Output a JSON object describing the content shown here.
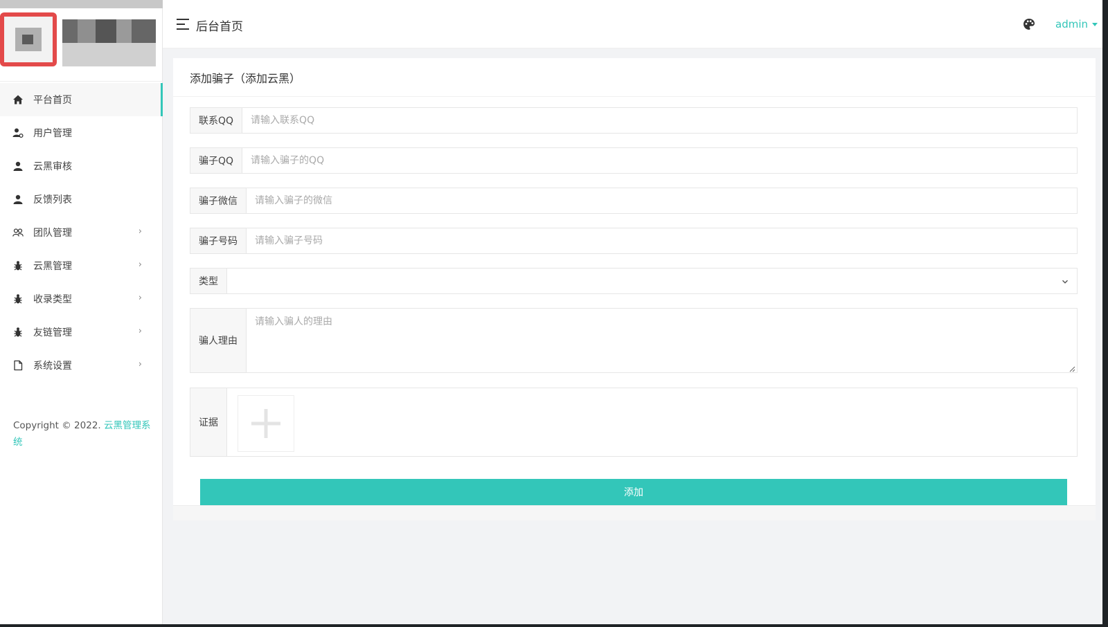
{
  "header": {
    "title": "后台首页",
    "user": "admin"
  },
  "sidebar": {
    "items": [
      {
        "label": "平台首页",
        "icon": "home-icon"
      },
      {
        "label": "用户管理",
        "icon": "user-settings-icon"
      },
      {
        "label": "云黑审核",
        "icon": "user-icon"
      },
      {
        "label": "反馈列表",
        "icon": "user-icon"
      },
      {
        "label": "团队管理",
        "icon": "group-icon",
        "arrow": "›"
      },
      {
        "label": "云黑管理",
        "icon": "bug-icon",
        "arrow": "›"
      },
      {
        "label": "收录类型",
        "icon": "bug-icon",
        "arrow": "›"
      },
      {
        "label": "友链管理",
        "icon": "bug-icon",
        "arrow": "›"
      },
      {
        "label": "系统设置",
        "icon": "file-icon",
        "arrow": "›"
      }
    ],
    "copyright_prefix": "Copyright © 2022. ",
    "copyright_link": "云黑管理系统"
  },
  "form": {
    "title": "添加骗子（添加云黑）",
    "contact_qq": {
      "label": "联系QQ",
      "placeholder": "请输入联系QQ"
    },
    "scammer_qq": {
      "label": "骗子QQ",
      "placeholder": "请输入骗子的QQ"
    },
    "scammer_wechat": {
      "label": "骗子微信",
      "placeholder": "请输入骗子的微信"
    },
    "scammer_phone": {
      "label": "骗子号码",
      "placeholder": "请输入骗子号码"
    },
    "type": {
      "label": "类型",
      "value": ""
    },
    "reason": {
      "label": "骗人理由",
      "placeholder": "请输入骗人的理由"
    },
    "evidence": {
      "label": "证据"
    },
    "submit_label": "添加"
  },
  "colors": {
    "accent": "#33c6b9"
  }
}
